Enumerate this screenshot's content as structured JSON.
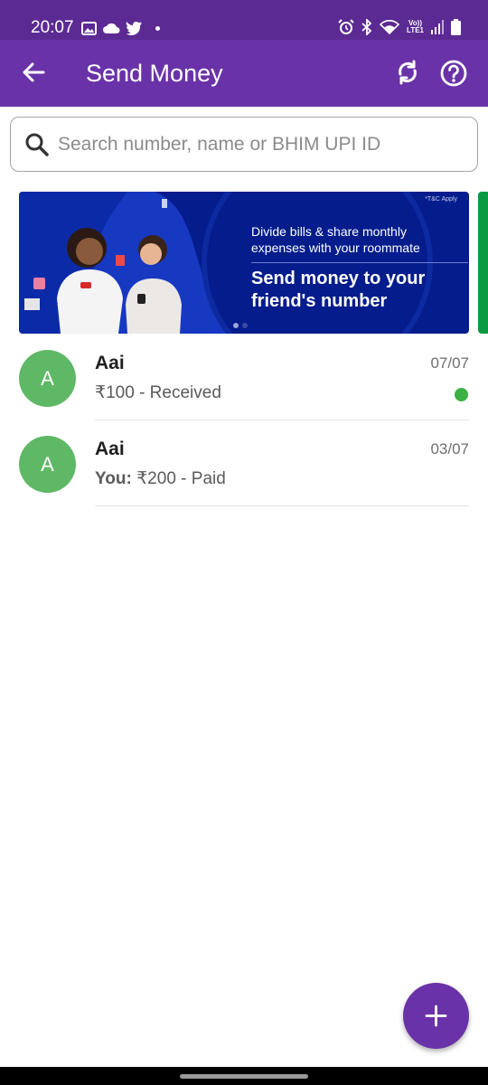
{
  "status_bar": {
    "time": "20:07",
    "left_icons": [
      "gallery-icon",
      "cloud-icon",
      "twitter-icon",
      "dot-icon"
    ],
    "volte_label": "Vo))\nLTE1",
    "right_icons": [
      "alarm-icon",
      "bluetooth-icon",
      "wifi-icon",
      "signal-icon",
      "battery-icon"
    ]
  },
  "app_bar": {
    "title": "Send Money",
    "back_icon": "arrow-left-icon",
    "sync_icon": "sync-icon",
    "help_icon": "help-circle-icon"
  },
  "search": {
    "placeholder": "Search number, name or BHIM UPI ID",
    "value": ""
  },
  "banner": {
    "tc": "*T&C Apply",
    "small_text": "Divide bills & share monthly expenses with your roommate",
    "big_text": "Send money to your friend's number",
    "pages": 2,
    "active_page": 1
  },
  "transactions": [
    {
      "initial": "A",
      "name": "Aai",
      "date": "07/07",
      "prefix": "",
      "detail": "₹100 - Received",
      "unread": true
    },
    {
      "initial": "A",
      "name": "Aai",
      "date": "03/07",
      "prefix": "You:",
      "detail": " ₹200 - Paid",
      "unread": false
    }
  ],
  "fab": {
    "icon": "plus-icon"
  },
  "colors": {
    "status_bar": "#5b2a93",
    "app_bar": "#6a32a8",
    "avatar": "#5fb865",
    "unread_dot": "#3cb043",
    "banner_bg": "#041c8c"
  }
}
